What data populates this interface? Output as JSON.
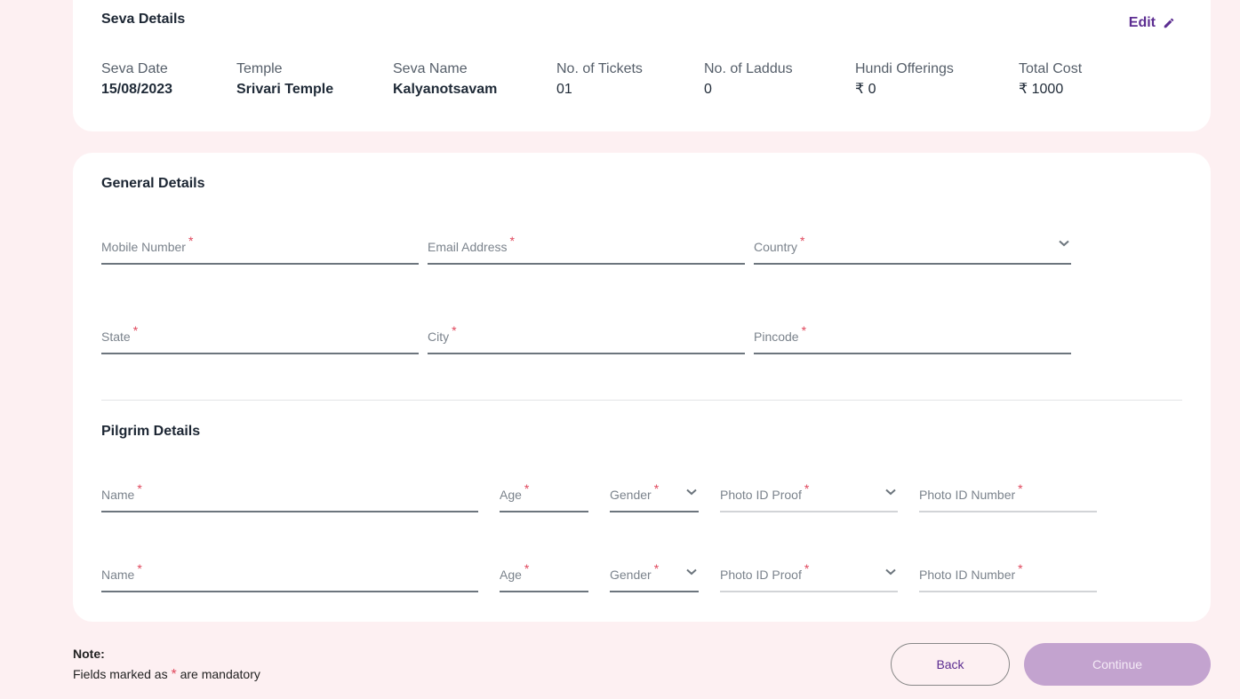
{
  "seva_details": {
    "title": "Seva Details",
    "edit_label": "Edit",
    "items": [
      {
        "label": "Seva Date",
        "value": "15/08/2023"
      },
      {
        "label": "Temple",
        "value": "Srivari Temple"
      },
      {
        "label": "Seva Name",
        "value": "Kalyanotsavam"
      },
      {
        "label": "No. of Tickets",
        "value": "01"
      },
      {
        "label": "No. of Laddus",
        "value": "0"
      },
      {
        "label": "Hundi Offerings",
        "value": "₹ 0"
      },
      {
        "label": "Total Cost",
        "value": "₹ 1000"
      }
    ]
  },
  "general_details": {
    "title": "General Details",
    "fields": {
      "mobile": {
        "label": "Mobile Number",
        "value": ""
      },
      "email": {
        "label": "Email Address",
        "value": ""
      },
      "country": {
        "label": "Country",
        "value": ""
      },
      "state": {
        "label": "State",
        "value": ""
      },
      "city": {
        "label": "City",
        "value": ""
      },
      "pincode": {
        "label": "Pincode",
        "value": ""
      }
    }
  },
  "pilgrim_details": {
    "title": "Pilgrim Details",
    "pilgrims": [
      {
        "name": "Name",
        "age": "Age",
        "gender": "Gender",
        "photo_id_proof": "Photo ID Proof",
        "photo_id_number": "Photo ID Number"
      },
      {
        "name": "Name",
        "age": "Age",
        "gender": "Gender",
        "photo_id_proof": "Photo ID Proof",
        "photo_id_number": "Photo ID Number"
      }
    ]
  },
  "required_marker": "*",
  "note": {
    "title": "Note:",
    "text_before": "Fields marked as",
    "marker": "*",
    "text_after": "are mandatory"
  },
  "buttons": {
    "back": "Back",
    "continue": "Continue"
  },
  "colors": {
    "brand": "#5c2d91",
    "required": "#e0475c",
    "continue_disabled": "#c3a3cf",
    "background": "#fdf0f2"
  }
}
